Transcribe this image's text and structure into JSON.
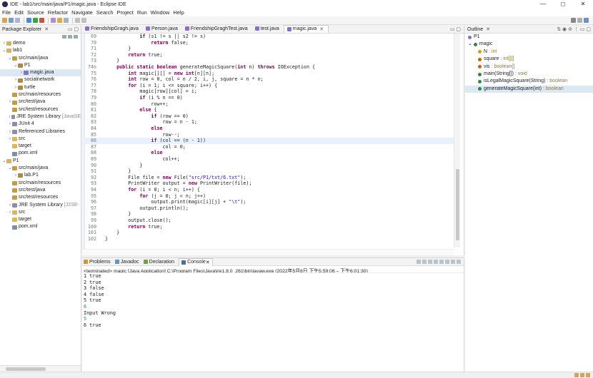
{
  "window": {
    "title": "IDE - lab1/src/main/java/P1/magic.java - Eclipse IDE",
    "controls": [
      "—",
      "◻",
      "✕"
    ]
  },
  "menu": [
    "File",
    "Edit",
    "Source",
    "Refactor",
    "Navigate",
    "Search",
    "Project",
    "Run",
    "Window",
    "Help"
  ],
  "package_explorer": {
    "title": "Package Explorer",
    "items": [
      {
        "indent": 0,
        "arrow": "›",
        "icon": "project-icon",
        "label": "demo",
        "extra": ""
      },
      {
        "indent": 0,
        "arrow": "⌄",
        "icon": "project-icon",
        "label": "lab1",
        "extra": ""
      },
      {
        "indent": 1,
        "arrow": "⌄",
        "icon": "source-folder-icon",
        "label": "src/main/java",
        "extra": ""
      },
      {
        "indent": 2,
        "arrow": "⌄",
        "icon": "package-icon",
        "label": "P1",
        "extra": ""
      },
      {
        "indent": 3,
        "arrow": "›",
        "icon": "java-file-icon",
        "label": "magic.java",
        "extra": "",
        "selected": true
      },
      {
        "indent": 2,
        "arrow": "›",
        "icon": "package-icon",
        "label": "socialnetwork",
        "extra": ""
      },
      {
        "indent": 2,
        "arrow": "›",
        "icon": "package-icon",
        "label": "turtle",
        "extra": ""
      },
      {
        "indent": 1,
        "arrow": "",
        "icon": "source-folder-icon",
        "label": "src/main/resources",
        "extra": ""
      },
      {
        "indent": 1,
        "arrow": "›",
        "icon": "source-folder-icon",
        "label": "src/test/java",
        "extra": ""
      },
      {
        "indent": 1,
        "arrow": "",
        "icon": "source-folder-icon",
        "label": "src/test/resources",
        "extra": ""
      },
      {
        "indent": 1,
        "arrow": "›",
        "icon": "library-icon",
        "label": "JRE System Library",
        "extra": "[JavaSE"
      },
      {
        "indent": 1,
        "arrow": "›",
        "icon": "library-icon",
        "label": "JUnit 4",
        "extra": ""
      },
      {
        "indent": 1,
        "arrow": "›",
        "icon": "library-icon",
        "label": "Referenced Libraries",
        "extra": ""
      },
      {
        "indent": 1,
        "arrow": "›",
        "icon": "folder-icon",
        "label": "src",
        "extra": ""
      },
      {
        "indent": 1,
        "arrow": "",
        "icon": "folder-icon",
        "label": "target",
        "extra": ""
      },
      {
        "indent": 1,
        "arrow": "",
        "icon": "xml-file-icon",
        "label": "pom.xml",
        "extra": ""
      },
      {
        "indent": 0,
        "arrow": "⌄",
        "icon": "project-icon",
        "label": "P1",
        "extra": ""
      },
      {
        "indent": 1,
        "arrow": "⌄",
        "icon": "source-folder-icon",
        "label": "src/main/java",
        "extra": ""
      },
      {
        "indent": 2,
        "arrow": "›",
        "icon": "package-icon",
        "label": "lab.P1",
        "extra": ""
      },
      {
        "indent": 1,
        "arrow": "",
        "icon": "source-folder-icon",
        "label": "src/main/resources",
        "extra": ""
      },
      {
        "indent": 1,
        "arrow": "",
        "icon": "source-folder-icon",
        "label": "src/test/java",
        "extra": ""
      },
      {
        "indent": 1,
        "arrow": "",
        "icon": "source-folder-icon",
        "label": "src/test/resources",
        "extra": ""
      },
      {
        "indent": 1,
        "arrow": "›",
        "icon": "library-icon",
        "label": "JRE System Library",
        "extra": "[J2SE-"
      },
      {
        "indent": 1,
        "arrow": "›",
        "icon": "folder-icon",
        "label": "src",
        "extra": ""
      },
      {
        "indent": 1,
        "arrow": "",
        "icon": "folder-icon",
        "label": "target",
        "extra": ""
      },
      {
        "indent": 1,
        "arrow": "",
        "icon": "xml-file-icon",
        "label": "pom.xml",
        "extra": ""
      }
    ]
  },
  "editor": {
    "tabs": [
      {
        "label": "FriendshipGragh.java",
        "active": false
      },
      {
        "label": "Person.java",
        "active": false
      },
      {
        "label": "FriendshipGraghTest.java",
        "active": false
      },
      {
        "label": "test.java",
        "active": false
      },
      {
        "label": "magic.java",
        "active": true
      }
    ],
    "highlighted_line": 86,
    "lines": [
      {
        "n": "69",
        "code": "            if (s1 != s || s2 != s)"
      },
      {
        "n": "70",
        "code": "                return false;"
      },
      {
        "n": "71",
        "code": "        }"
      },
      {
        "n": "72",
        "code": "        return true;"
      },
      {
        "n": "73",
        "code": "    }"
      },
      {
        "n": "74⊖",
        "code": "    public static boolean generateMagicSquare(int n) throws IOException {"
      },
      {
        "n": "75",
        "code": "        int magic[][] = new int[n][n];"
      },
      {
        "n": "76",
        "code": "        int row = 0, col = n / 2, i, j, square = n * n;"
      },
      {
        "n": "77",
        "code": "        for (i = 1; i <= square; i++) {"
      },
      {
        "n": "78",
        "code": "            magic[row][col] = i;"
      },
      {
        "n": "79",
        "code": "            if (i % n == 0)"
      },
      {
        "n": "80",
        "code": "                row++;"
      },
      {
        "n": "81",
        "code": "            else {"
      },
      {
        "n": "82",
        "code": "                if (row == 0)"
      },
      {
        "n": "83",
        "code": "                    row = n - 1;"
      },
      {
        "n": "84",
        "code": "                else"
      },
      {
        "n": "85",
        "code": "                    row--;"
      },
      {
        "n": "86",
        "code": "                if (col == (n - 1))"
      },
      {
        "n": "87",
        "code": "                    col = 0;"
      },
      {
        "n": "88",
        "code": "                else"
      },
      {
        "n": "89",
        "code": "                    col++;"
      },
      {
        "n": "90",
        "code": "            }"
      },
      {
        "n": "91",
        "code": "        }"
      },
      {
        "n": "92",
        "code": "        File file = new File(\"src/P1/txt/6.txt\");"
      },
      {
        "n": "93",
        "code": "        PrintWriter output = new PrintWriter(file);"
      },
      {
        "n": "94",
        "code": "        for (i = 0; i < n; i++) {"
      },
      {
        "n": "95",
        "code": "            for (j = 0; j < n; j++)"
      },
      {
        "n": "96",
        "code": "                output.print(magic[i][j] + \"\\t\");"
      },
      {
        "n": "97",
        "code": "            output.println();"
      },
      {
        "n": "98",
        "code": "        }"
      },
      {
        "n": "99",
        "code": "        output.close();"
      },
      {
        "n": "100",
        "code": "        return true;"
      },
      {
        "n": "101",
        "code": "    }"
      },
      {
        "n": "102",
        "code": "}"
      }
    ]
  },
  "outline": {
    "title": "Outline",
    "items": [
      {
        "indent": 0,
        "label": "P1",
        "type": "",
        "color": "#8c6ad1"
      },
      {
        "indent": 0,
        "label": "magic",
        "type": "",
        "color": "#2c8a3e",
        "arrow": "⌄"
      },
      {
        "indent": 1,
        "label": "N",
        "type": ": int",
        "color": "#c8a500"
      },
      {
        "indent": 1,
        "label": "square",
        "type": ": int[][]",
        "color": "#c86400"
      },
      {
        "indent": 1,
        "label": "vis",
        "type": ": boolean[]",
        "color": "#c86400"
      },
      {
        "indent": 1,
        "label": "main(String[])",
        "type": ": void",
        "color": "#2c8a3e"
      },
      {
        "indent": 1,
        "label": "isLegalMagicSquare(String)",
        "type": ": boolean",
        "color": "#2c8a3e"
      },
      {
        "indent": 1,
        "label": "generateMagicSquare(int)",
        "type": ": boolean",
        "color": "#2c8a3e",
        "selected": true
      }
    ]
  },
  "console": {
    "tabs": [
      "Problems",
      "Javadoc",
      "Declaration",
      "Console"
    ],
    "active_tab": "Console",
    "status": "<terminated> magic [Java Application] C:\\Program Files\\Java\\jre1.8.0_261\\bin\\javaw.exe  (2022年5月8日 下午5:59:06 – 下午6:01:30)",
    "output": [
      {
        "text": "1 true",
        "input": false
      },
      {
        "text": "2 true",
        "input": false
      },
      {
        "text": "3 false",
        "input": false
      },
      {
        "text": "4 false",
        "input": false
      },
      {
        "text": "5 true",
        "input": false
      },
      {
        "text": "6",
        "input": true
      },
      {
        "text": "Input Wrong",
        "input": false
      },
      {
        "text": "5",
        "input": true
      },
      {
        "text": "6 true",
        "input": false
      }
    ]
  }
}
